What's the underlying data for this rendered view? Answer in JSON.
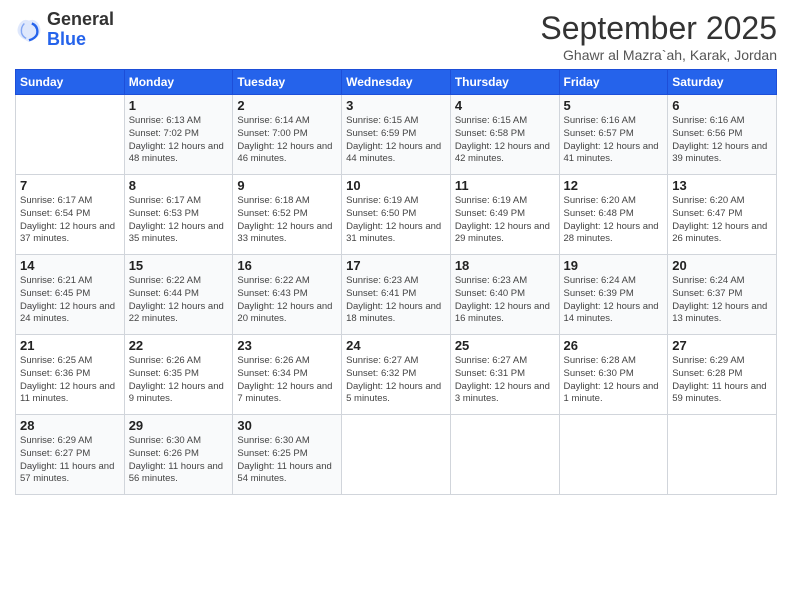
{
  "logo": {
    "general": "General",
    "blue": "Blue"
  },
  "header": {
    "month": "September 2025",
    "location": "Ghawr al Mazra`ah, Karak, Jordan"
  },
  "days_of_week": [
    "Sunday",
    "Monday",
    "Tuesday",
    "Wednesday",
    "Thursday",
    "Friday",
    "Saturday"
  ],
  "weeks": [
    [
      {
        "day": "",
        "info": ""
      },
      {
        "day": "1",
        "info": "Sunrise: 6:13 AM\nSunset: 7:02 PM\nDaylight: 12 hours and 48 minutes."
      },
      {
        "day": "2",
        "info": "Sunrise: 6:14 AM\nSunset: 7:00 PM\nDaylight: 12 hours and 46 minutes."
      },
      {
        "day": "3",
        "info": "Sunrise: 6:15 AM\nSunset: 6:59 PM\nDaylight: 12 hours and 44 minutes."
      },
      {
        "day": "4",
        "info": "Sunrise: 6:15 AM\nSunset: 6:58 PM\nDaylight: 12 hours and 42 minutes."
      },
      {
        "day": "5",
        "info": "Sunrise: 6:16 AM\nSunset: 6:57 PM\nDaylight: 12 hours and 41 minutes."
      },
      {
        "day": "6",
        "info": "Sunrise: 6:16 AM\nSunset: 6:56 PM\nDaylight: 12 hours and 39 minutes."
      }
    ],
    [
      {
        "day": "7",
        "info": "Sunrise: 6:17 AM\nSunset: 6:54 PM\nDaylight: 12 hours and 37 minutes."
      },
      {
        "day": "8",
        "info": "Sunrise: 6:17 AM\nSunset: 6:53 PM\nDaylight: 12 hours and 35 minutes."
      },
      {
        "day": "9",
        "info": "Sunrise: 6:18 AM\nSunset: 6:52 PM\nDaylight: 12 hours and 33 minutes."
      },
      {
        "day": "10",
        "info": "Sunrise: 6:19 AM\nSunset: 6:50 PM\nDaylight: 12 hours and 31 minutes."
      },
      {
        "day": "11",
        "info": "Sunrise: 6:19 AM\nSunset: 6:49 PM\nDaylight: 12 hours and 29 minutes."
      },
      {
        "day": "12",
        "info": "Sunrise: 6:20 AM\nSunset: 6:48 PM\nDaylight: 12 hours and 28 minutes."
      },
      {
        "day": "13",
        "info": "Sunrise: 6:20 AM\nSunset: 6:47 PM\nDaylight: 12 hours and 26 minutes."
      }
    ],
    [
      {
        "day": "14",
        "info": "Sunrise: 6:21 AM\nSunset: 6:45 PM\nDaylight: 12 hours and 24 minutes."
      },
      {
        "day": "15",
        "info": "Sunrise: 6:22 AM\nSunset: 6:44 PM\nDaylight: 12 hours and 22 minutes."
      },
      {
        "day": "16",
        "info": "Sunrise: 6:22 AM\nSunset: 6:43 PM\nDaylight: 12 hours and 20 minutes."
      },
      {
        "day": "17",
        "info": "Sunrise: 6:23 AM\nSunset: 6:41 PM\nDaylight: 12 hours and 18 minutes."
      },
      {
        "day": "18",
        "info": "Sunrise: 6:23 AM\nSunset: 6:40 PM\nDaylight: 12 hours and 16 minutes."
      },
      {
        "day": "19",
        "info": "Sunrise: 6:24 AM\nSunset: 6:39 PM\nDaylight: 12 hours and 14 minutes."
      },
      {
        "day": "20",
        "info": "Sunrise: 6:24 AM\nSunset: 6:37 PM\nDaylight: 12 hours and 13 minutes."
      }
    ],
    [
      {
        "day": "21",
        "info": "Sunrise: 6:25 AM\nSunset: 6:36 PM\nDaylight: 12 hours and 11 minutes."
      },
      {
        "day": "22",
        "info": "Sunrise: 6:26 AM\nSunset: 6:35 PM\nDaylight: 12 hours and 9 minutes."
      },
      {
        "day": "23",
        "info": "Sunrise: 6:26 AM\nSunset: 6:34 PM\nDaylight: 12 hours and 7 minutes."
      },
      {
        "day": "24",
        "info": "Sunrise: 6:27 AM\nSunset: 6:32 PM\nDaylight: 12 hours and 5 minutes."
      },
      {
        "day": "25",
        "info": "Sunrise: 6:27 AM\nSunset: 6:31 PM\nDaylight: 12 hours and 3 minutes."
      },
      {
        "day": "26",
        "info": "Sunrise: 6:28 AM\nSunset: 6:30 PM\nDaylight: 12 hours and 1 minute."
      },
      {
        "day": "27",
        "info": "Sunrise: 6:29 AM\nSunset: 6:28 PM\nDaylight: 11 hours and 59 minutes."
      }
    ],
    [
      {
        "day": "28",
        "info": "Sunrise: 6:29 AM\nSunset: 6:27 PM\nDaylight: 11 hours and 57 minutes."
      },
      {
        "day": "29",
        "info": "Sunrise: 6:30 AM\nSunset: 6:26 PM\nDaylight: 11 hours and 56 minutes."
      },
      {
        "day": "30",
        "info": "Sunrise: 6:30 AM\nSunset: 6:25 PM\nDaylight: 11 hours and 54 minutes."
      },
      {
        "day": "",
        "info": ""
      },
      {
        "day": "",
        "info": ""
      },
      {
        "day": "",
        "info": ""
      },
      {
        "day": "",
        "info": ""
      }
    ]
  ]
}
